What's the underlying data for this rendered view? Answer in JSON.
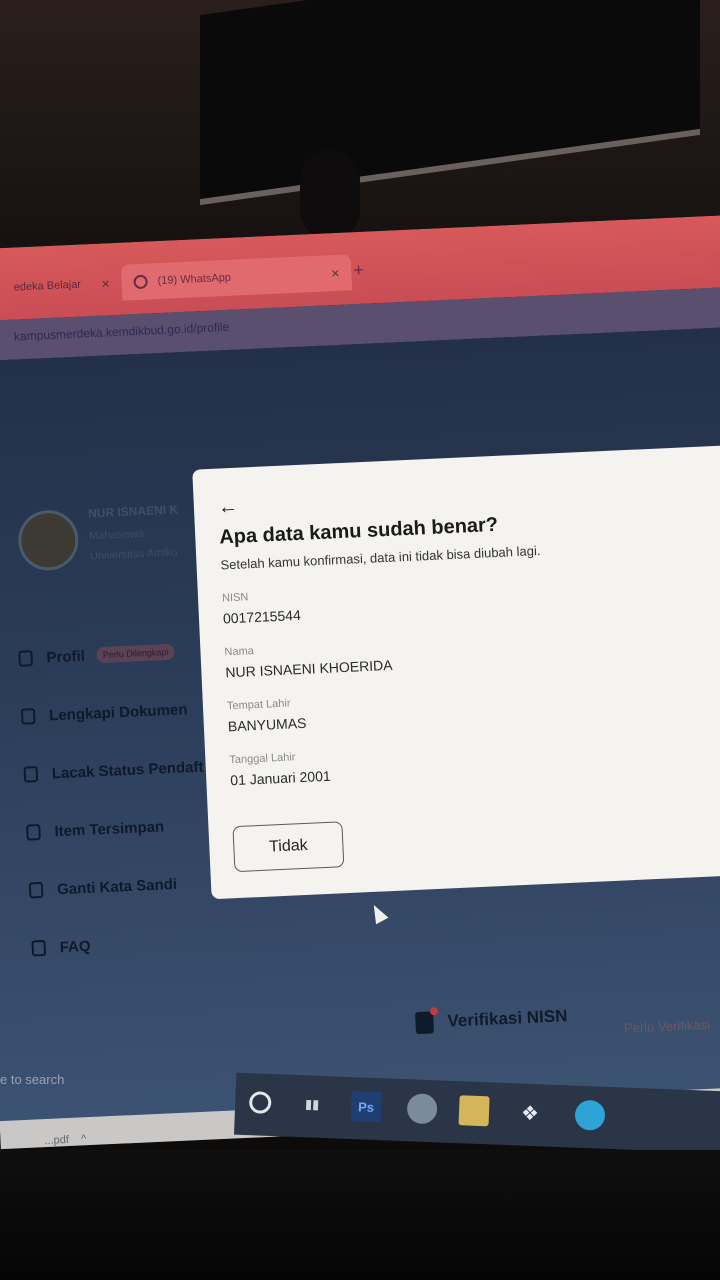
{
  "browser": {
    "tabs": [
      {
        "label": "edeka Belajar",
        "close": "×"
      },
      {
        "label": "(19) WhatsApp",
        "close": "×"
      }
    ],
    "new_tab": "+",
    "url": "kampusmerdeka.kemdikbud.go.id/profile"
  },
  "profile": {
    "name": "NUR ISNAENI K",
    "role": "Mahasiswa",
    "university": "Universitas Amiko"
  },
  "sidebar": {
    "items": [
      {
        "label": "Profil",
        "badge": "Perlu Dilengkapi"
      },
      {
        "label": "Lengkapi Dokumen"
      },
      {
        "label": "Lacak Status Pendaft"
      },
      {
        "label": "Item Tersimpan"
      },
      {
        "label": "Ganti Kata Sandi"
      },
      {
        "label": "FAQ"
      }
    ]
  },
  "verification": {
    "label": "Verifikasi NISN",
    "status": "Perlu Verifikasi"
  },
  "dialog": {
    "back": "←",
    "title": "Apa data kamu sudah benar?",
    "subtitle": "Setelah kamu konfirmasi, data ini tidak bisa diubah lagi.",
    "fields": [
      {
        "label": "NISN",
        "value": "0017215544"
      },
      {
        "label": "Nama",
        "value": "NUR ISNAENI KHOERIDA"
      },
      {
        "label": "Tempat Lahir",
        "value": "BANYUMAS"
      },
      {
        "label": "Tanggal Lahir",
        "value": "01 Januari 2001"
      }
    ],
    "no_button": "Tidak"
  },
  "downloads": {
    "file": "...pdf",
    "chevron": "^"
  },
  "taskbar": {
    "search_hint": "e to search",
    "ps_label": "Ps"
  }
}
